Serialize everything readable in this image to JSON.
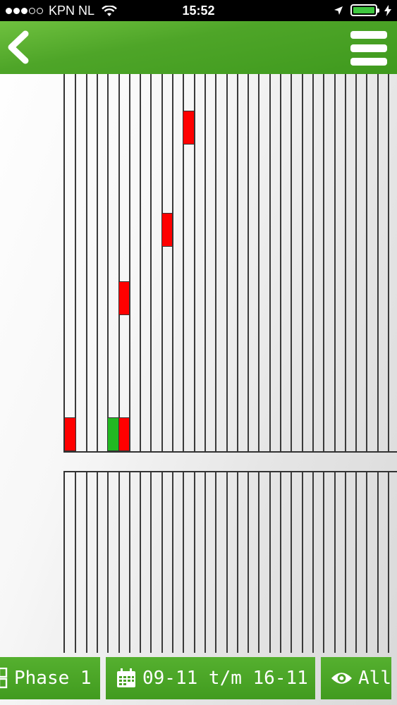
{
  "status_bar": {
    "carrier": "KPN NL",
    "time": "15:52",
    "signal_strength": 3,
    "signal_max": 5,
    "battery_color": "#3ec63e"
  },
  "nav": {
    "bar_color": "#4ea528"
  },
  "grid": {
    "columns": 31,
    "cells": [
      {
        "col": 0,
        "row": 10,
        "color": "red"
      },
      {
        "col": 4,
        "row": 10,
        "color": "green"
      },
      {
        "col": 5,
        "row": 10,
        "color": "red"
      },
      {
        "col": 5,
        "row": 6,
        "color": "red"
      },
      {
        "col": 9,
        "row": 4,
        "color": "red"
      },
      {
        "col": 11,
        "row": 1,
        "color": "red"
      }
    ]
  },
  "toolbar": {
    "phase_label": "Phase 1",
    "date_label": "09-11 t/m 16-11",
    "view_label": "All"
  }
}
